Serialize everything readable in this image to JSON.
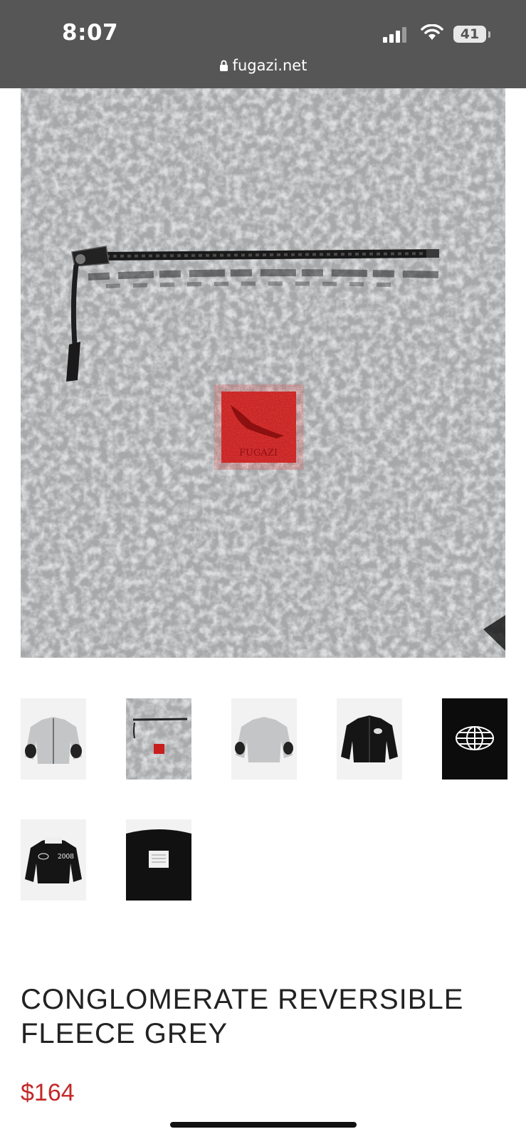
{
  "status_bar": {
    "time": "8:07",
    "battery": "41",
    "url": "fugazi.net"
  },
  "gallery": {
    "main_image": "fleece-pocket-closeup",
    "patch_text": "FUGAZI",
    "thumbnails": [
      {
        "name": "grey-jacket-front"
      },
      {
        "name": "fleece-pocket-closeup"
      },
      {
        "name": "grey-jacket-back"
      },
      {
        "name": "black-jacket-front"
      },
      {
        "name": "globe-logo"
      },
      {
        "name": "black-jacket-2008",
        "text": "2008"
      },
      {
        "name": "black-jacket-back-label"
      }
    ]
  },
  "product": {
    "title": "CONGLOMERATE REVERSIBLE FLEECE GREY",
    "price": "$164"
  },
  "colors": {
    "status_bar_bg": "#565656",
    "price": "#c42828",
    "fleece": "#b4b6b8",
    "patch": "#c81e1e"
  }
}
